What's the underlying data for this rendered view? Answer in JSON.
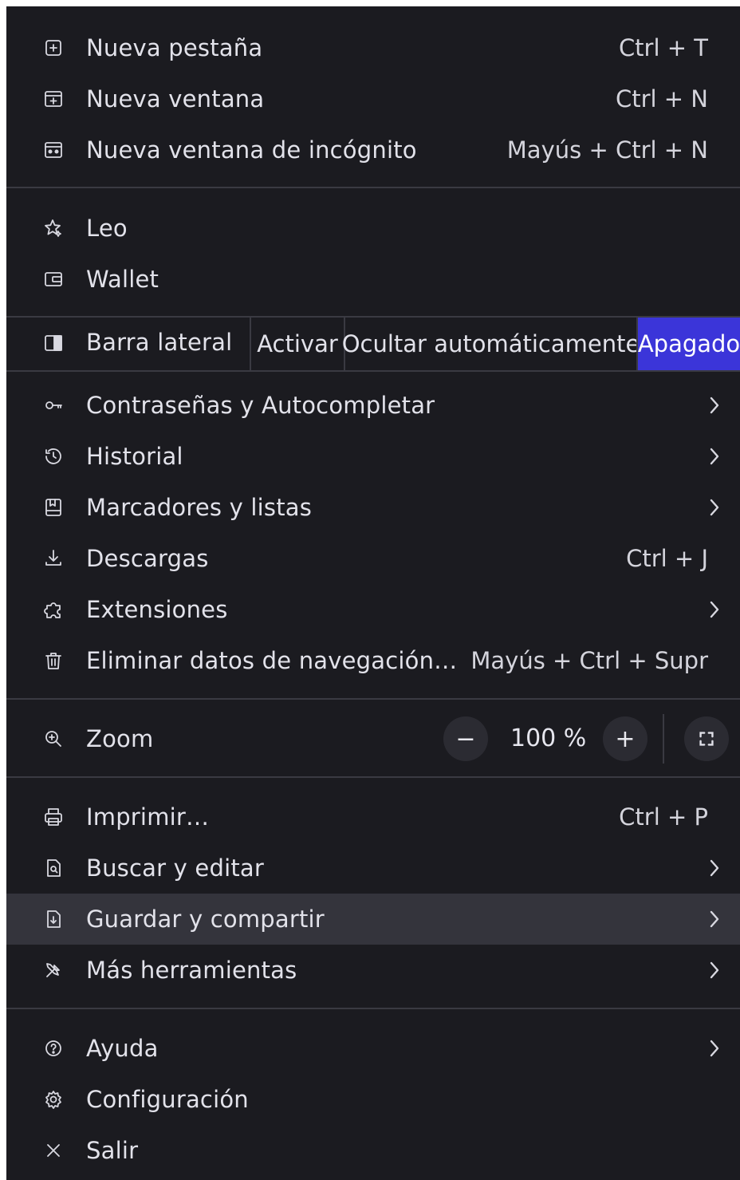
{
  "menu": {
    "group1": [
      {
        "label": "Nueva pestaña",
        "shortcut": "Ctrl + T",
        "icon": "new-tab-icon"
      },
      {
        "label": "Nueva ventana",
        "shortcut": "Ctrl + N",
        "icon": "new-window-icon"
      },
      {
        "label": "Nueva ventana de incógnito",
        "shortcut": "Mayús + Ctrl + N",
        "icon": "incognito-icon"
      }
    ],
    "group2": [
      {
        "label": "Leo",
        "icon": "leo-icon"
      },
      {
        "label": "Wallet",
        "icon": "wallet-icon"
      }
    ],
    "sidebar": {
      "label": "Barra lateral",
      "icon": "sidebar-icon",
      "options": [
        "Activar",
        "Ocultar automáticamente",
        "Apagado"
      ],
      "selected": "Apagado",
      "accent": "#3b35d9"
    },
    "group3": [
      {
        "label": "Contraseñas y Autocompletar",
        "icon": "key-icon",
        "submenu": true
      },
      {
        "label": "Historial",
        "icon": "history-icon",
        "submenu": true
      },
      {
        "label": "Marcadores y listas",
        "icon": "bookmarks-icon",
        "submenu": true
      },
      {
        "label": "Descargas",
        "shortcut": "Ctrl + J",
        "icon": "download-icon"
      },
      {
        "label": "Extensiones",
        "icon": "puzzle-icon",
        "submenu": true
      },
      {
        "label": "Eliminar datos de navegación…",
        "shortcut": "Mayús + Ctrl + Supr",
        "icon": "trash-icon"
      }
    ],
    "zoom": {
      "label": "Zoom",
      "icon": "zoom-icon",
      "value": "100 %",
      "minus": "−",
      "plus": "+"
    },
    "group4": [
      {
        "label": "Imprimir…",
        "shortcut": "Ctrl + P",
        "icon": "print-icon"
      },
      {
        "label": "Buscar y editar",
        "icon": "find-icon",
        "submenu": true
      },
      {
        "label": "Guardar y compartir",
        "icon": "save-icon",
        "submenu": true,
        "highlighted": true
      },
      {
        "label": "Más herramientas",
        "icon": "tools-icon",
        "submenu": true
      }
    ],
    "group5": [
      {
        "label": "Ayuda",
        "icon": "help-icon",
        "submenu": true
      },
      {
        "label": "Configuración",
        "icon": "gear-icon"
      },
      {
        "label": "Salir",
        "icon": "close-icon"
      }
    ]
  }
}
